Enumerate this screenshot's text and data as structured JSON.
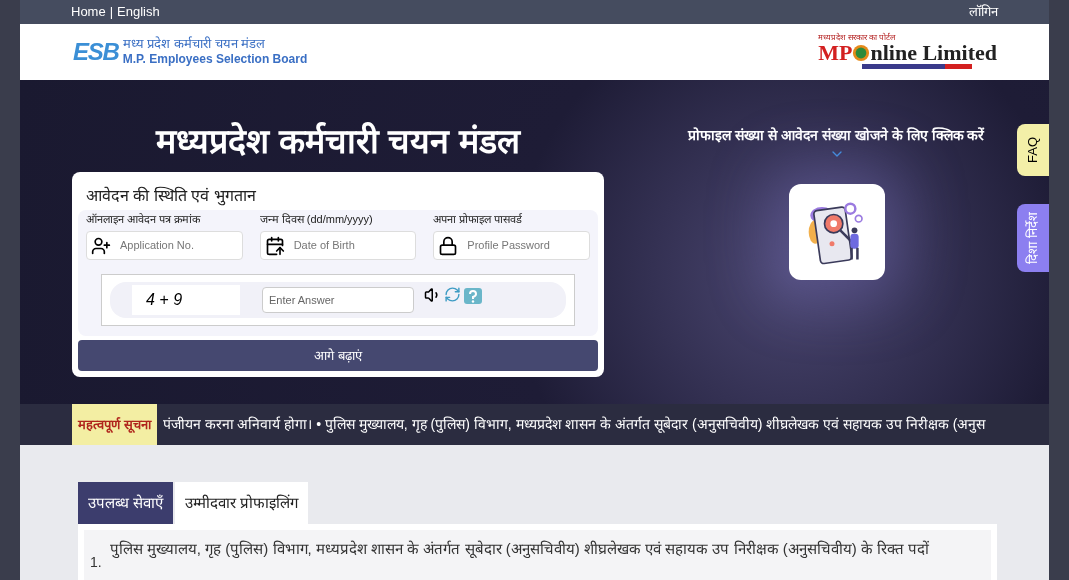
{
  "top_bar": {
    "links": [
      "Home",
      "English"
    ],
    "separator": "|",
    "login": "लॉगिन"
  },
  "header": {
    "esb_logo": {
      "letters": "ESB",
      "hindi": "मध्य प्रदेश कर्मचारी चयन मंडल",
      "english": "M.P. Employees Selection Board"
    },
    "mponline_logo": {
      "tagline_top": "मध्यप्रदेश सरकार का पोर्टल",
      "name_left": "MP",
      "name_right": "nline Limited"
    }
  },
  "hero": {
    "title": "मध्यप्रदेश कर्मचारी चयन मंडल",
    "form": {
      "title": "आवेदन की स्थिति एवं भुगतान",
      "fields": [
        {
          "kind": "user",
          "label": "ऑनलाइन आवेदन पत्र क्रमांक",
          "placeholder": "Application No."
        },
        {
          "kind": "date",
          "label": "जन्म दिवस (dd/mm/yyyy)",
          "placeholder": "Date of Birth"
        },
        {
          "kind": "lock",
          "label": "अपना प्रोफाइल पासवर्ड",
          "placeholder": "Profile Password"
        }
      ],
      "captcha": {
        "question": "4 + 9",
        "placeholder": "Enter Answer"
      },
      "submit": "आगे बढ़ाएं"
    },
    "search_prompt": "प्रोफाइल संख्या से आवेदन संख्या खोजने के लिए क्लिक करें"
  },
  "side_tabs": [
    {
      "label": "FAQ",
      "color": "#f3efa8"
    },
    {
      "label": "दिशा निर्देश",
      "color": "#8c7ff0"
    }
  ],
  "ticker": {
    "label": "महत्वपूर्ण सूचना",
    "text": "पंजीयन करना अनिवार्य होगा। • पुलिस मुख्यालय, गृह (पुलिस) विभाग, मध्यप्रदेश शासन के अंतर्गत सूबेदार (अनुसचिवीय) शीघ्रलेखक एवं सहायक उप निरीक्षक (अनुस"
  },
  "tabs": [
    {
      "label": "उपलब्ध सेवाएँ",
      "selected": true
    },
    {
      "label": "उम्मीदवार प्रोफाइलिंग",
      "selected": false
    }
  ],
  "notices": [
    {
      "number": "1.",
      "text": "पुलिस मुख्यालय, गृह (पुलिस) विभाग, मध्यप्रदेश शासन के अंतर्गत सूबेदार (अनुसचिवीय) शीघ्रलेखक एवं सहायक उप निरीक्षक (अनुसचिवीय) के रिक्त पदों"
    }
  ]
}
